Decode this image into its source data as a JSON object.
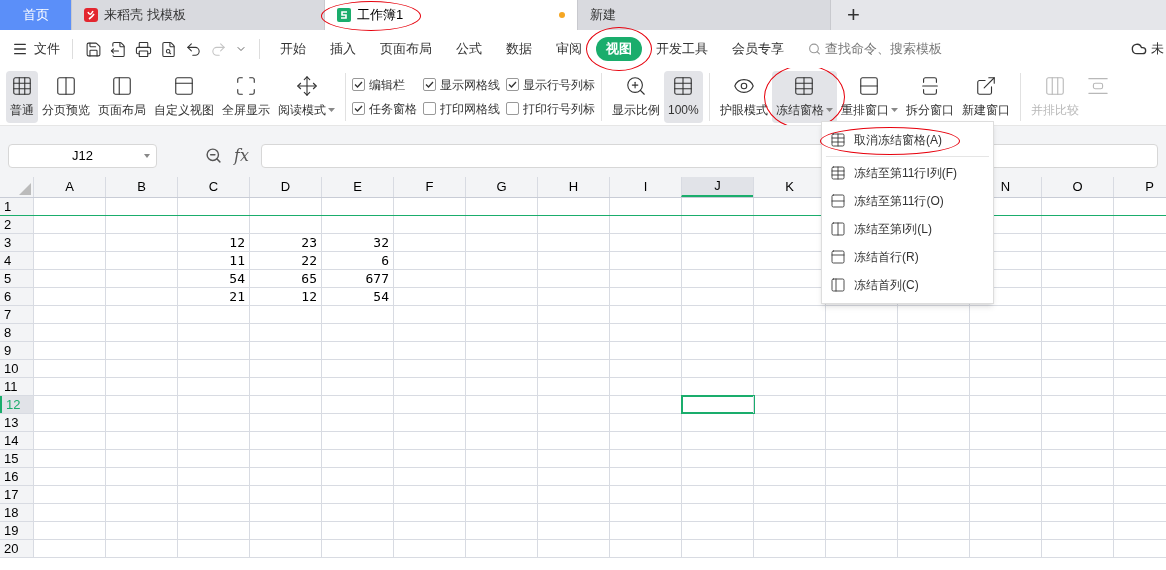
{
  "doc_tabs": [
    {
      "kind": "home",
      "label": "首页",
      "selected": false,
      "circled": false,
      "modified": false
    },
    {
      "kind": "docer",
      "label": "来稻壳 找模板",
      "selected": false,
      "circled": false,
      "modified": false
    },
    {
      "kind": "sheet",
      "label": "工作簿1",
      "selected": true,
      "circled": true,
      "modified": true
    },
    {
      "kind": "plain",
      "label": "新建",
      "selected": false,
      "circled": false,
      "modified": false
    }
  ],
  "add_tab": "+",
  "file_menu": "文件",
  "quick_tools": [
    {
      "kind": "save",
      "disabled": false
    },
    {
      "kind": "export",
      "disabled": false
    },
    {
      "kind": "print",
      "disabled": false
    },
    {
      "kind": "preview",
      "disabled": false
    },
    {
      "kind": "undo",
      "disabled": false
    },
    {
      "kind": "redo",
      "disabled": true
    },
    {
      "kind": "more",
      "disabled": false
    }
  ],
  "menu_tabs": [
    {
      "label": "开始",
      "selected": false,
      "circled": false
    },
    {
      "label": "插入",
      "selected": false,
      "circled": false
    },
    {
      "label": "页面布局",
      "selected": false,
      "circled": false
    },
    {
      "label": "公式",
      "selected": false,
      "circled": false
    },
    {
      "label": "数据",
      "selected": false,
      "circled": false
    },
    {
      "label": "审阅",
      "selected": false,
      "circled": false
    },
    {
      "label": "视图",
      "selected": true,
      "circled": true
    },
    {
      "label": "开发工具",
      "selected": false,
      "circled": false
    },
    {
      "label": "会员专享",
      "selected": false,
      "circled": false
    }
  ],
  "search": {
    "placeholder": "查找命令、搜索模板"
  },
  "cloud_status": "未",
  "ribbon": [
    {
      "kind": "buttons",
      "items": [
        {
          "kind": "grid",
          "label": "普通",
          "selected": true,
          "dropdown": false,
          "disabled": false,
          "circled": false
        },
        {
          "kind": "pages",
          "label": "分页预览",
          "selected": false,
          "dropdown": false,
          "disabled": false,
          "circled": false
        },
        {
          "kind": "layout",
          "label": "页面布局",
          "selected": false,
          "dropdown": false,
          "disabled": false,
          "circled": false
        },
        {
          "kind": "custom",
          "label": "自定义视图",
          "selected": false,
          "dropdown": false,
          "disabled": false,
          "circled": false
        },
        {
          "kind": "fullscreen",
          "label": "全屏显示",
          "selected": false,
          "dropdown": false,
          "disabled": false,
          "circled": false
        },
        {
          "kind": "cross",
          "label": "阅读模式",
          "selected": false,
          "dropdown": true,
          "disabled": false,
          "circled": false
        }
      ]
    },
    {
      "kind": "checks",
      "items": [
        {
          "label": "编辑栏",
          "checked": true
        },
        {
          "label": "任务窗格",
          "checked": true
        },
        {
          "label": "显示网格线",
          "checked": true
        },
        {
          "label": "打印网格线",
          "checked": false
        },
        {
          "label": "显示行号列标",
          "checked": true
        },
        {
          "label": "打印行号列标",
          "checked": false
        }
      ]
    },
    {
      "kind": "buttons",
      "items": [
        {
          "kind": "zoom",
          "label": "显示比例",
          "selected": false,
          "dropdown": false,
          "disabled": false,
          "circled": false
        },
        {
          "kind": "ratio",
          "label": "100%",
          "selected": true,
          "dropdown": false,
          "disabled": false,
          "circled": false
        }
      ]
    },
    {
      "kind": "buttons",
      "items": [
        {
          "kind": "eye",
          "label": "护眼模式",
          "selected": false,
          "dropdown": false,
          "disabled": false,
          "circled": false
        },
        {
          "kind": "freeze",
          "label": "冻结窗格",
          "selected": true,
          "dropdown": true,
          "disabled": false,
          "circled": true
        },
        {
          "kind": "arrange",
          "label": "重排窗口",
          "selected": false,
          "dropdown": true,
          "disabled": false,
          "circled": false
        },
        {
          "kind": "split",
          "label": "拆分窗口",
          "selected": false,
          "dropdown": false,
          "disabled": false,
          "circled": false
        },
        {
          "kind": "newwin",
          "label": "新建窗口",
          "selected": false,
          "dropdown": false,
          "disabled": false,
          "circled": false
        }
      ]
    },
    {
      "kind": "buttons",
      "items": [
        {
          "kind": "compare",
          "label": "并排比较",
          "selected": false,
          "dropdown": false,
          "disabled": true,
          "circled": false
        },
        {
          "kind": "sync",
          "selected": false,
          "disabled": true,
          "circled": false
        }
      ]
    }
  ],
  "name_box": "J12",
  "formula_bar": {
    "fx": "fx"
  },
  "freeze_menu": [
    {
      "kind": "unfreeze",
      "label": "取消冻结窗格(A)",
      "circled": true
    },
    {
      "kind": "both",
      "label": "冻结至第11行I列(F)",
      "circled": false
    },
    {
      "kind": "rows",
      "label": "冻结至第11行(O)",
      "circled": false
    },
    {
      "kind": "cols",
      "label": "冻结至第I列(L)",
      "circled": false
    },
    {
      "kind": "firstrow",
      "label": "冻结首行(R)",
      "circled": false
    },
    {
      "kind": "firstcol",
      "label": "冻结首列(C)",
      "circled": false
    }
  ],
  "sheet": {
    "columns": [
      {
        "label": "A",
        "selected": false
      },
      {
        "label": "B",
        "selected": false
      },
      {
        "label": "C",
        "selected": false
      },
      {
        "label": "D",
        "selected": false
      },
      {
        "label": "E",
        "selected": false
      },
      {
        "label": "F",
        "selected": false
      },
      {
        "label": "G",
        "selected": false
      },
      {
        "label": "H",
        "selected": false
      },
      {
        "label": "I",
        "selected": false
      },
      {
        "label": "J",
        "selected": true
      },
      {
        "label": "K",
        "selected": false
      },
      {},
      {},
      {
        "label": "N",
        "selected": false
      },
      {
        "label": "O",
        "selected": false
      },
      {
        "label": "P",
        "selected": false
      }
    ],
    "rows": [
      {
        "label": "1",
        "selected": false,
        "frozen_below": true
      },
      {
        "label": "2",
        "selected": false,
        "frozen_below": false
      },
      {
        "label": "3",
        "selected": false,
        "frozen_below": false,
        "cells": [
          null,
          null,
          "12",
          "23",
          "32"
        ]
      },
      {
        "label": "4",
        "selected": false,
        "frozen_below": false,
        "cells": [
          null,
          null,
          "11",
          "22",
          "6"
        ]
      },
      {
        "label": "5",
        "selected": false,
        "frozen_below": false,
        "cells": [
          null,
          null,
          "54",
          "65",
          "677"
        ]
      },
      {
        "label": "6",
        "selected": false,
        "frozen_below": false,
        "cells": [
          null,
          null,
          "21",
          "12",
          "54"
        ]
      },
      {
        "label": "7",
        "selected": false,
        "frozen_below": false
      },
      {
        "label": "8",
        "selected": false,
        "frozen_below": false
      },
      {
        "label": "9",
        "selected": false,
        "frozen_below": false
      },
      {
        "label": "10",
        "selected": false,
        "frozen_below": false
      },
      {
        "label": "11",
        "selected": false,
        "frozen_below": false
      },
      {
        "label": "12",
        "selected": true,
        "frozen_below": false
      },
      {
        "label": "13",
        "selected": false,
        "frozen_below": false
      },
      {
        "label": "14",
        "selected": false,
        "frozen_below": false
      },
      {
        "label": "15",
        "selected": false,
        "frozen_below": false
      },
      {
        "label": "16",
        "selected": false,
        "frozen_below": false
      },
      {
        "label": "17",
        "selected": false,
        "frozen_below": false
      },
      {
        "label": "18",
        "selected": false,
        "frozen_below": false
      },
      {
        "label": "19",
        "selected": false,
        "frozen_below": false
      },
      {
        "label": "20",
        "selected": false,
        "frozen_below": false
      }
    ]
  }
}
